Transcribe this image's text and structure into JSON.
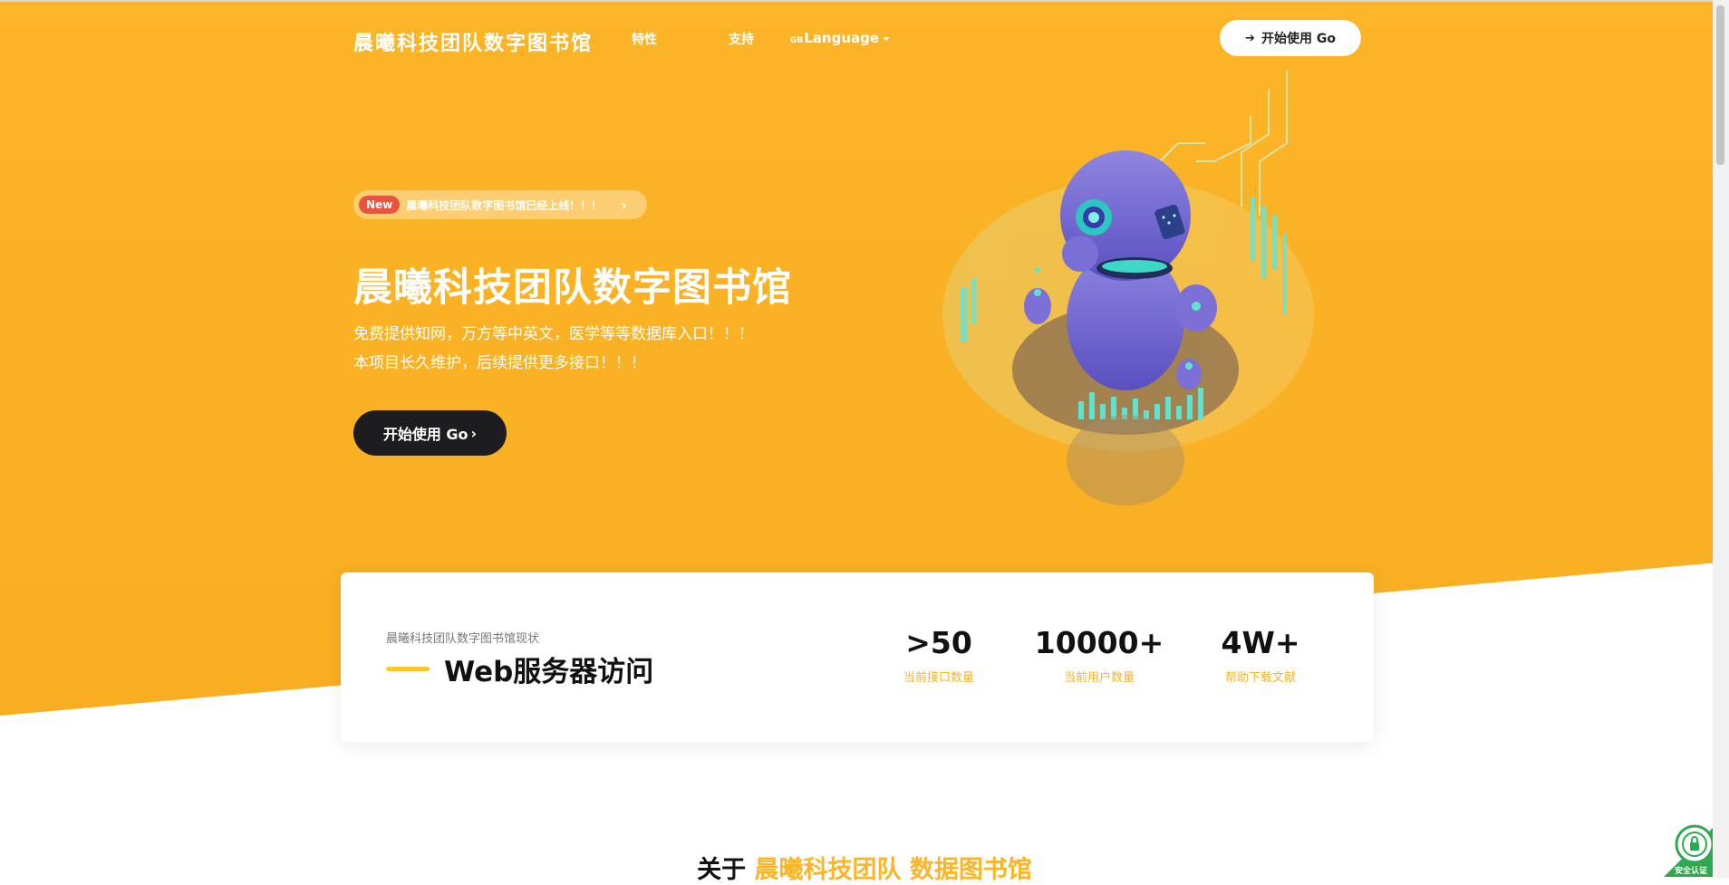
{
  "nav": {
    "brand": "晨曦科技团队数字图书馆",
    "items": [
      "特性",
      "支持"
    ],
    "language_label": "Language",
    "language_flag": "GB",
    "cta_label": "开始使用 Go"
  },
  "hero": {
    "announce_badge": "New",
    "announce_text": "晨曦科技团队数字图书馆已经上线！！！",
    "title": "晨曦科技团队数字图书馆",
    "desc_line1": "免费提供知网，万方等中英文，医学等等数据库入口！！！",
    "desc_line2": "本项目长久维护，后续提供更多接口！！！",
    "button_label": "开始使用 Go"
  },
  "stats": {
    "subtitle": "晨曦科技团队数字图书馆现状",
    "title": "Web服务器访问",
    "items": [
      {
        "value": ">50",
        "label": "当前接口数量"
      },
      {
        "value": "10000+",
        "label": "当前用户数量"
      },
      {
        "value": "4W+",
        "label": "帮助下载文献"
      }
    ]
  },
  "about": {
    "prefix": "关于",
    "highlight": "晨曦科技团队 数据图书馆"
  },
  "badge": {
    "label": "安全认证"
  },
  "colors": {
    "accent": "#FBB526",
    "dark_button": "#1d1d1f",
    "new_badge": "#E8553E",
    "stat_label": "#F7B32B"
  }
}
